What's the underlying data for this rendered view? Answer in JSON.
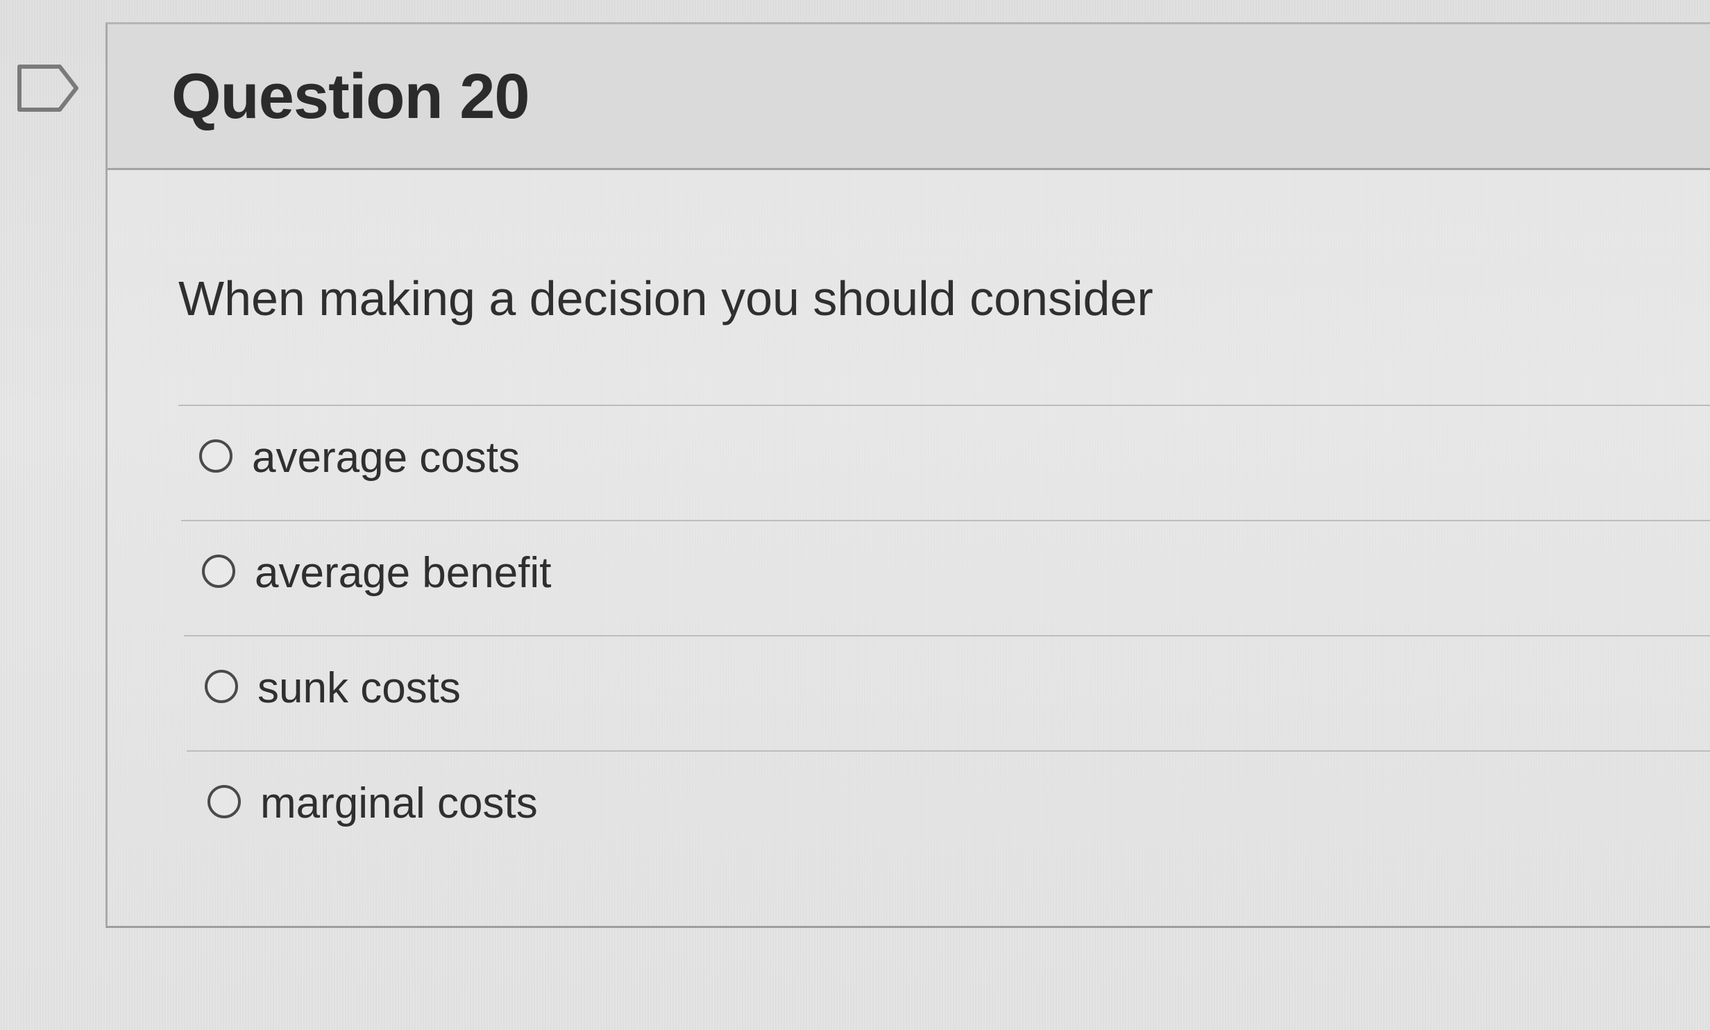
{
  "question": {
    "title": "Question 20",
    "text": "When making a decision you should consider",
    "flag_icon": "flag-outline-icon"
  },
  "answers": [
    {
      "label": "average costs",
      "selected": false
    },
    {
      "label": "average benefit",
      "selected": false
    },
    {
      "label": "sunk costs",
      "selected": false
    },
    {
      "label": "marginal costs",
      "selected": false
    }
  ]
}
